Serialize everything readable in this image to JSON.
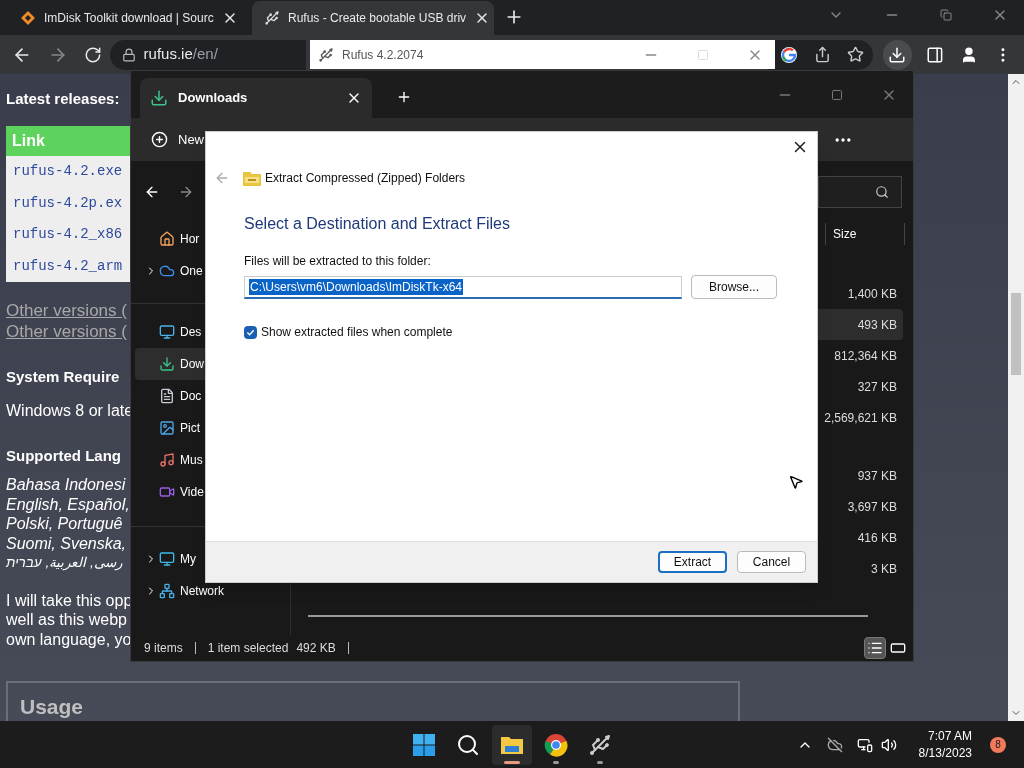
{
  "browser": {
    "tabs": [
      {
        "title": "ImDisk Toolkit download | Sourc",
        "kind": "diamond",
        "selected": false
      },
      {
        "title": "Rufus - Create bootable USB driv",
        "kind": "usb",
        "selected": true
      }
    ],
    "address": {
      "host": "rufus.ie",
      "path": "/en/"
    }
  },
  "page": {
    "latest_title": "Latest releases:",
    "table_header": "Link",
    "downloads": [
      "rufus-4.2.exe",
      "rufus-4.2p.ex",
      "rufus-4.2_x86",
      "rufus-4.2_arm"
    ],
    "other_links": [
      "Other versions (",
      "Other versions ("
    ],
    "requirements_title": "System Require",
    "requirements_text": "Windows 8 or late",
    "languages_title": "Supported Lang",
    "languages": [
      "Bahasa Indonesi",
      "English, Español,",
      "Polski, Portuguê",
      "Suomi, Svenska,",
      "رسی, العربية, עברית"
    ],
    "note": [
      "I will take this opp",
      "well as this webp",
      "own language, yo"
    ],
    "usage_title": "Usage"
  },
  "rufus_window": {
    "title": "Rufus 4.2.2074"
  },
  "explorer": {
    "tab": "Downloads",
    "new_label": "New",
    "sidebar": [
      [
        {
          "label": "Hor",
          "kind": "home",
          "expandable": false,
          "selected": false
        },
        {
          "label": "One",
          "kind": "cloud",
          "expandable": true,
          "selected": false
        }
      ],
      [
        {
          "label": "Des",
          "kind": "desktop",
          "expandable": false,
          "selected": false
        },
        {
          "label": "Dow",
          "kind": "download",
          "expandable": false,
          "selected": true
        },
        {
          "label": "Doc",
          "kind": "document",
          "expandable": false,
          "selected": false
        },
        {
          "label": "Pict",
          "kind": "picture",
          "expandable": false,
          "selected": false
        },
        {
          "label": "Mus",
          "kind": "music",
          "expandable": false,
          "selected": false
        },
        {
          "label": "Vide",
          "kind": "video",
          "expandable": false,
          "selected": false
        }
      ],
      [
        {
          "label": "My",
          "kind": "pc",
          "expandable": true,
          "selected": false
        },
        {
          "label": "Network",
          "kind": "network",
          "expandable": true,
          "selected": false
        }
      ]
    ],
    "column": "Size",
    "size_groups": [
      [
        {
          "text": "1,400 KB",
          "selected": false
        },
        {
          "text": "493 KB",
          "selected": true
        },
        {
          "text": "812,364 KB",
          "selected": false
        },
        {
          "text": "327 KB",
          "selected": false
        },
        {
          "text": "2,569,621 KB",
          "selected": false
        }
      ],
      [
        {
          "text": "937 KB",
          "selected": false
        },
        {
          "text": "3,697 KB",
          "selected": false
        },
        {
          "text": "416 KB",
          "selected": false
        },
        {
          "text": "3 KB",
          "selected": false
        }
      ]
    ],
    "status": {
      "count": "9 items",
      "selection": "1 item selected",
      "size": "492 KB"
    },
    "views": [
      {
        "kind": "details",
        "selected": true
      },
      {
        "kind": "tiles",
        "selected": false
      }
    ]
  },
  "dialog": {
    "title": "Extract Compressed (Zipped) Folders",
    "heading": "Select a Destination and Extract Files",
    "folder_label": "Files will be extracted to this folder:",
    "path": "C:\\Users\\vm6\\Downloads\\ImDiskTk-x64",
    "browse": "Browse...",
    "show_files": {
      "label": "Show extracted files when complete",
      "checked": true
    },
    "buttons": [
      {
        "label": "Extract",
        "default": true
      },
      {
        "label": "Cancel",
        "default": false
      }
    ]
  },
  "taskbar": {
    "apps": [
      {
        "kind": "start",
        "active": false,
        "running": false
      },
      {
        "kind": "search",
        "active": false,
        "running": false
      },
      {
        "kind": "explorer",
        "active": true,
        "running": true
      },
      {
        "kind": "chrome",
        "active": false,
        "running": true
      },
      {
        "kind": "usb",
        "active": false,
        "running": true
      }
    ],
    "time": "7:07 AM",
    "date": "8/13/2023",
    "badge": "8"
  }
}
